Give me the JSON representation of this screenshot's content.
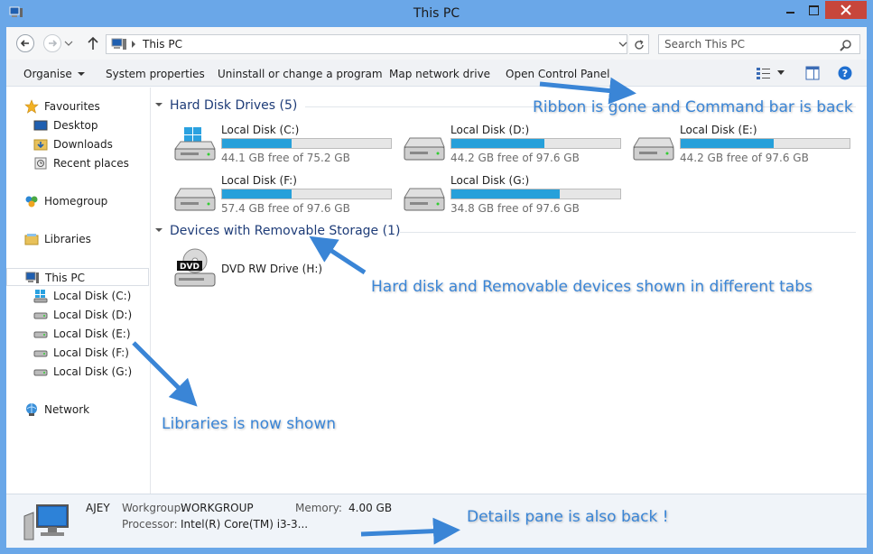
{
  "window": {
    "title": "This PC"
  },
  "address": {
    "location": "This PC",
    "search_placeholder": "Search This PC"
  },
  "commands": [
    {
      "label": "Organise",
      "has_dropdown": true
    },
    {
      "label": "System properties"
    },
    {
      "label": "Uninstall or change a program"
    },
    {
      "label": "Map network drive"
    },
    {
      "label": "Open Control Panel"
    }
  ],
  "nav": {
    "favourites": "Favourites",
    "desktop": "Desktop",
    "downloads": "Downloads",
    "recent": "Recent places",
    "homegroup": "Homegroup",
    "libraries": "Libraries",
    "thispc": "This PC",
    "drives": [
      "Local Disk (C:)",
      "Local Disk (D:)",
      "Local Disk (E:)",
      "Local Disk (F:)",
      "Local Disk (G:)"
    ],
    "network": "Network"
  },
  "groups": {
    "hdd": "Hard Disk Drives (5)",
    "removable": "Devices with Removable Storage (1)"
  },
  "drives": [
    {
      "name": "Local Disk (C:)",
      "free": "44.1 GB free of 75.2 GB",
      "used_fraction": 0.41,
      "system": true
    },
    {
      "name": "Local Disk (D:)",
      "free": "44.2 GB free of 97.6 GB",
      "used_fraction": 0.55
    },
    {
      "name": "Local Disk (E:)",
      "free": "44.2 GB free of 97.6 GB",
      "used_fraction": 0.55
    },
    {
      "name": "Local Disk (F:)",
      "free": "57.4 GB free of 97.6 GB",
      "used_fraction": 0.41
    },
    {
      "name": "Local Disk (G:)",
      "free": "34.8 GB free of 97.6 GB",
      "used_fraction": 0.64
    }
  ],
  "dvd": {
    "name": "DVD RW Drive (H:)",
    "icon_text": "DVD"
  },
  "details": {
    "computer": "AJEY",
    "workgroup_label": "Workgroup:",
    "workgroup": "WORKGROUP",
    "memory_label": "Memory:",
    "memory": "4.00 GB",
    "processor_label": "Processor:",
    "processor": "Intel(R) Core(TM) i3-3..."
  },
  "annotations": {
    "ribbon": "Ribbon is gone and Command bar is back",
    "tabs": "Hard disk and Removable devices shown in different tabs",
    "libraries": "Libraries is now shown",
    "details": "Details pane is also back !"
  },
  "colors": {
    "accent": "#6aa7e8",
    "bar_fill": "#26a0da",
    "close": "#c7463b",
    "annotation": "#3a85d6",
    "group_header": "#1e3c78"
  }
}
